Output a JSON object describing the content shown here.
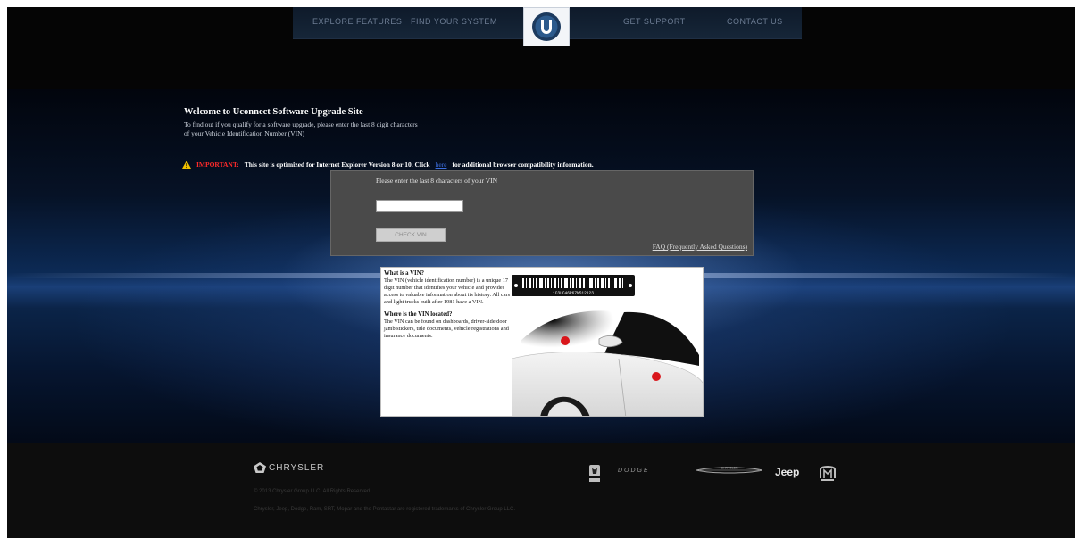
{
  "nav": {
    "items": [
      "EXPLORE FEATURES",
      "FIND YOUR SYSTEM",
      "GET SUPPORT",
      "CONTACT US"
    ]
  },
  "hero": {
    "title": "Welcome to Uconnect Software Upgrade Site",
    "intro_line1": "To find out if you qualify for a software upgrade, please enter the last 8 digit characters",
    "intro_line2": "of your Vehicle Identification Number (VIN)",
    "notice_prefix": "IMPORTANT:",
    "notice_text": "This site is optimized for Internet Explorer Version 8 or 10. Click",
    "notice_link": "here",
    "notice_suffix": "for additional browser compatibility information."
  },
  "vin_form": {
    "label": "Please enter the last 8 characters of your VIN",
    "input_value": "",
    "button_label": "CHECK VIN",
    "faq_link": "FAQ (Frequently Asked Questions)"
  },
  "vin_info": {
    "what_title": "What is a VIN?",
    "what_text": "The VIN (vehicle identification number) is a unique 17 digit number that identifies your vehicle and provides access to valuable information about its history. All cars and light trucks built after 1981 have a VIN.",
    "where_title": "Where is the VIN located?",
    "where_text": "The VIN can be found on dashboards, driver-side door jamb stickers, title documents, vehicle registrations and insurance documents.",
    "barcode_digits": "1C3LC46R67N512123"
  },
  "footer": {
    "group_logo": "CHRYSLER",
    "copyright": "© 2013 Chrysler Group LLC. All Rights Reserved.",
    "trademark": "Chrysler, Jeep, Dodge, Ram, SRT, Mopar and the Pentastar are registered trademarks of Chrysler Group LLC.",
    "brand_dodge": "DODGE",
    "brand_chrysler": "CHRYSLER",
    "brand_jeep": "Jeep"
  },
  "colors": {
    "important_red": "#ff2a2a",
    "link_blue": "#3d6fe0",
    "panel_gray": "#4a4a4a"
  }
}
